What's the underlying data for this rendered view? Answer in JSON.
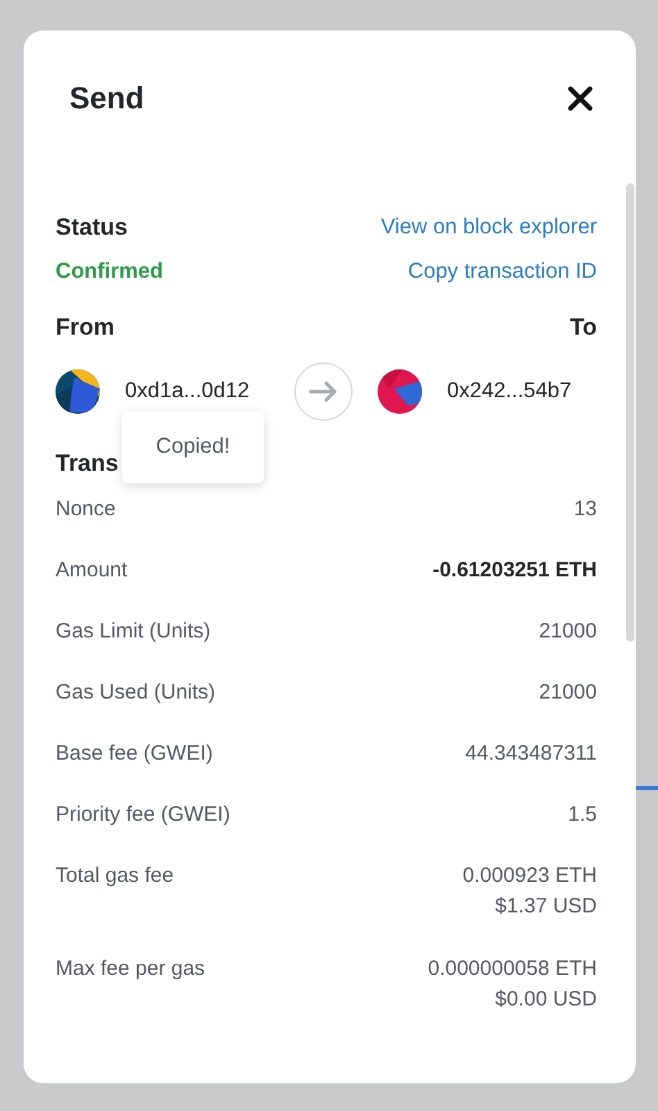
{
  "dialog": {
    "title": "Send"
  },
  "status": {
    "label": "Status",
    "value": "Confirmed",
    "kind": "confirmed",
    "links": [
      "View on block explorer",
      "Copy transaction ID"
    ]
  },
  "transfer": {
    "from_label": "From",
    "to_label": "To",
    "from_address": "0xd1a...0d12",
    "to_address": "0x242...54b7"
  },
  "tooltip": {
    "text": "Copied!"
  },
  "details": {
    "heading": "Trans",
    "rows": [
      {
        "label": "Nonce",
        "values": [
          "13"
        ],
        "bold": false
      },
      {
        "label": "Amount",
        "values": [
          "-0.61203251 ETH"
        ],
        "bold": true
      },
      {
        "label": "Gas Limit (Units)",
        "values": [
          "21000"
        ],
        "bold": false
      },
      {
        "label": "Gas Used (Units)",
        "values": [
          "21000"
        ],
        "bold": false
      },
      {
        "label": "Base fee (GWEI)",
        "values": [
          "44.343487311"
        ],
        "bold": false
      },
      {
        "label": "Priority fee (GWEI)",
        "values": [
          "1.5"
        ],
        "bold": false
      },
      {
        "label": "Total gas fee",
        "values": [
          "0.000923 ETH",
          "$1.37 USD"
        ],
        "bold": false
      },
      {
        "label": "Max fee per gas",
        "values": [
          "0.000000058 ETH",
          "$0.00 USD"
        ],
        "bold": false
      }
    ]
  }
}
